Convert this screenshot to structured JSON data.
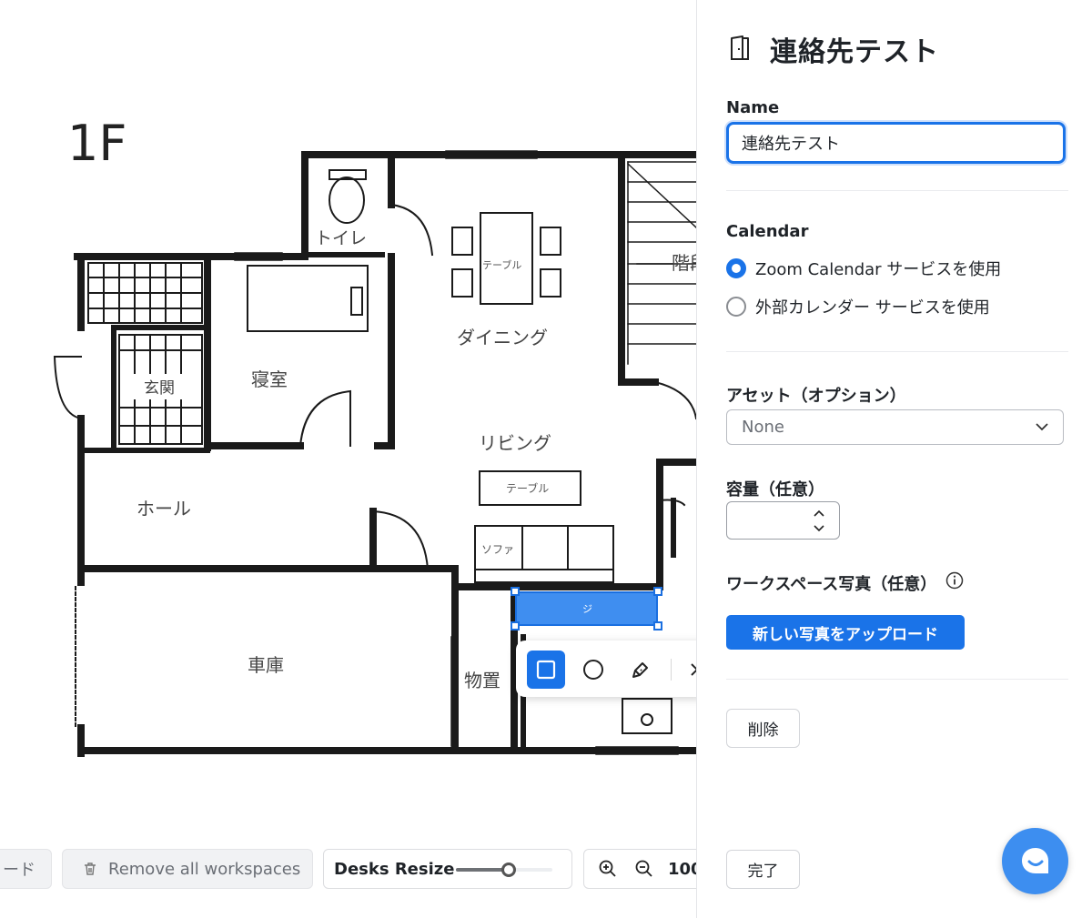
{
  "floorplan": {
    "floor_label": "1F",
    "rooms": {
      "toilet": "トイレ",
      "entrance": "玄関",
      "bedroom": "寝室",
      "dining": "ダイニング",
      "living": "リビング",
      "hall": "ホール",
      "garage": "車庫",
      "storage": "物置",
      "stairs": "階段",
      "table_dining": "テーブル",
      "table_living": "テーブル",
      "sofa": "ソファ"
    }
  },
  "selection": {
    "mark": "ジ"
  },
  "shape_toolbar": {
    "tools": [
      {
        "icon": "square-icon",
        "active": true
      },
      {
        "icon": "circle-icon",
        "active": false
      },
      {
        "icon": "pen-icon",
        "active": false
      }
    ],
    "close_icon": "close-icon"
  },
  "bottom_bar": {
    "partial_button_label": "ード",
    "remove_all_label": "Remove all workspaces",
    "remove_icon": "trash-icon",
    "desks_resize_label": "Desks Resize",
    "desks_resize_value": 0.55,
    "zoom_in_icon": "zoom-in-icon",
    "zoom_out_icon": "zoom-out-icon",
    "zoom_level": "100"
  },
  "panel": {
    "title_icon": "door-icon",
    "title": "連絡先テスト",
    "name_label": "Name",
    "name_value": "連絡先テスト",
    "calendar_label": "Calendar",
    "calendar_options": [
      {
        "label": "Zoom Calendar サービスを使用",
        "selected": true
      },
      {
        "label": "外部カレンダー サービスを使用",
        "selected": false
      }
    ],
    "asset_label": "アセット（オプション）",
    "asset_value": "None",
    "capacity_label": "容量（任意）",
    "capacity_value": "",
    "photo_label": "ワークスペース写真（任意）",
    "photo_info_icon": "info-icon",
    "upload_label": "新しい写真をアップロード",
    "delete_label": "削除",
    "done_label": "完了",
    "chat_icon": "chat-icon"
  },
  "colors": {
    "accent": "#1a73e8",
    "selection_fill": "#3f8ef0",
    "chat_fab": "#3d8ef0"
  }
}
